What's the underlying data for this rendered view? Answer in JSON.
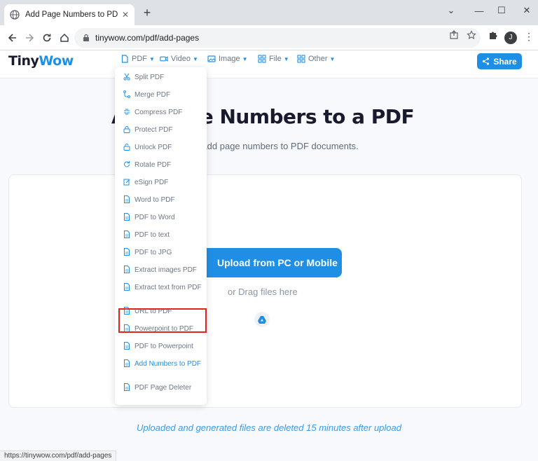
{
  "browser": {
    "tab_title": "Add Page Numbers to PDF Free",
    "url": "tinywow.com/pdf/add-pages",
    "avatar_initial": "J",
    "status_url": "https://tinywow.com/pdf/add-pages"
  },
  "site": {
    "logo_part1": "Tiny",
    "logo_part2": "Wow",
    "nav": [
      {
        "label": "PDF",
        "icon": "file-icon"
      },
      {
        "label": "Video",
        "icon": "video-icon"
      },
      {
        "label": "Image",
        "icon": "image-icon"
      },
      {
        "label": "File",
        "icon": "grid-icon"
      },
      {
        "label": "Other",
        "icon": "apps-icon"
      }
    ],
    "share_label": "Share"
  },
  "main": {
    "heading": "Add Page Numbers to a PDF",
    "subheading": "Add page numbers to PDF documents.",
    "upload_label": "Upload from PC or Mobile",
    "drag_label": "or Drag files here",
    "notice": "Uploaded and generated files are deleted 15 minutes after upload"
  },
  "dropdown": {
    "items": [
      {
        "label": "Split PDF",
        "icon": "scissors-icon"
      },
      {
        "label": "Merge PDF",
        "icon": "merge-icon"
      },
      {
        "label": "Compress PDF",
        "icon": "compress-icon"
      },
      {
        "label": "Protect PDF",
        "icon": "lock-icon"
      },
      {
        "label": "Unlock PDF",
        "icon": "unlock-icon"
      },
      {
        "label": "Rotate PDF",
        "icon": "rotate-icon"
      },
      {
        "label": "eSign PDF",
        "icon": "sign-icon"
      },
      {
        "label": "Word to PDF",
        "icon": "document-icon"
      },
      {
        "label": "PDF to Word",
        "icon": "document-icon"
      },
      {
        "label": "PDF to text",
        "icon": "document-icon"
      },
      {
        "label": "PDF to JPG",
        "icon": "document-icon"
      },
      {
        "label": "Extract images PDF",
        "icon": "document-icon"
      },
      {
        "label": "Extract text from PDF",
        "icon": "document-icon"
      },
      {
        "label": "URL to PDF",
        "icon": "document-icon"
      },
      {
        "label": "Powerpoint to PDF",
        "icon": "document-icon"
      },
      {
        "label": "PDF to Powerpoint",
        "icon": "document-icon"
      },
      {
        "label": "Add Numbers to PDF",
        "icon": "document-icon",
        "active": true
      },
      {
        "label": "PDF Page Deleter",
        "icon": "document-icon"
      }
    ]
  },
  "colors": {
    "accent": "#1f8fe6",
    "highlight_box": "#e2231a",
    "heading_text": "#1a1a2e"
  }
}
